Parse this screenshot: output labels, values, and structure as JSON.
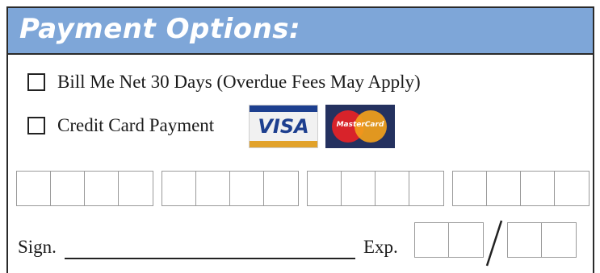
{
  "header": {
    "title": "Payment Options:"
  },
  "options": [
    {
      "label": "Bill Me Net 30 Days (Overdue Fees May Apply)",
      "checked": false
    },
    {
      "label": "Credit Card Payment",
      "checked": false
    }
  ],
  "cards": {
    "visa": {
      "text": "VISA",
      "icon": "visa-logo"
    },
    "mastercard": {
      "text": "MasterCard",
      "icon": "mastercard-logo"
    }
  },
  "card_number": {
    "groups": 4,
    "digits_per_group": 4
  },
  "signature": {
    "label": "Sign."
  },
  "expiration": {
    "label": "Exp.",
    "separator": "/"
  },
  "colors": {
    "header_bg": "#7ea6d8",
    "header_text": "#ffffff"
  }
}
